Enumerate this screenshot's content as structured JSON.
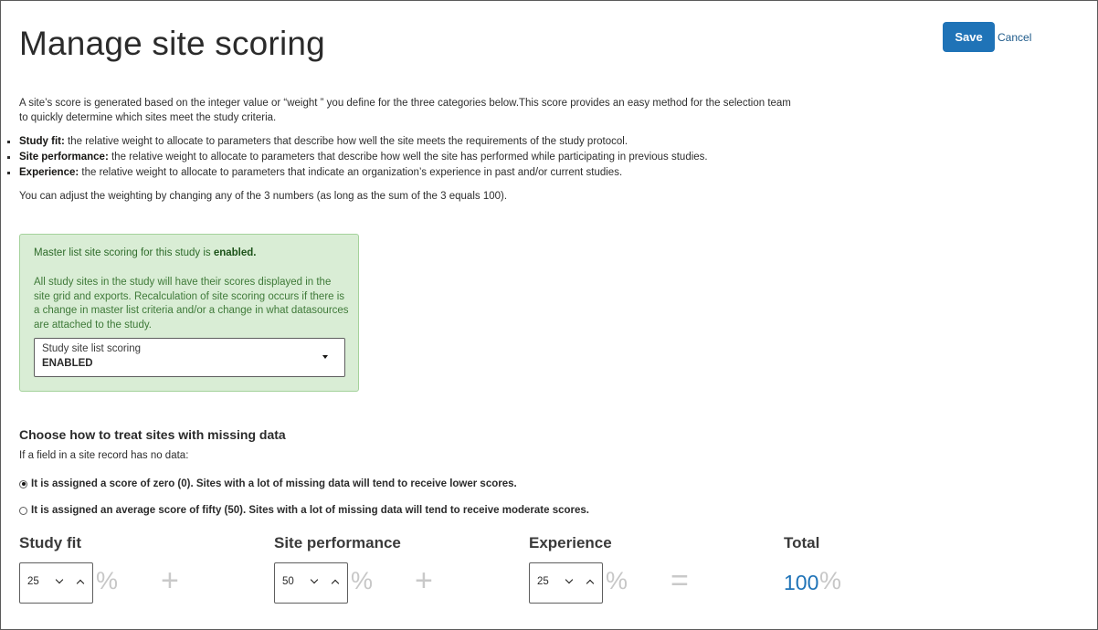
{
  "page": {
    "title": "Manage site scoring",
    "save_label": "Save",
    "cancel_label": "Cancel"
  },
  "intro": {
    "paragraph": "A site’s score is generated based on the integer value or “weight ” you define for the three categories below.This score provides an easy method for the selection team to quickly determine which sites meet the study criteria.",
    "bullets": [
      {
        "term": "Study fit:",
        "text": " the relative weight to allocate to parameters that describe how well the site meets the requirements of the study protocol."
      },
      {
        "term": "Site performance:",
        "text": " the relative weight to allocate to parameters that describe how well the site has performed while participating in previous studies."
      },
      {
        "term": "Experience:",
        "text": " the relative weight to allocate to parameters that indicate an organization’s experience in past and/or current studies."
      }
    ],
    "adjust_note": "You can adjust the weighting by changing any of the 3 numbers (as long as the sum of the 3 equals 100)."
  },
  "status_box": {
    "line_prefix": "Master list site scoring for this study is ",
    "line_status": "enabled.",
    "description": "All study sites in the study will have their scores displayed in the site grid and exports. Recalculation of site scoring occurs if there is a change in master list criteria and/or a change in what datasources are attached to the study.",
    "select_label": "Study site list scoring",
    "select_value": "ENABLED"
  },
  "missing_data": {
    "heading": "Choose how to treat sites with missing data",
    "subtext": "If a field in a site record has no data:",
    "options": [
      {
        "label": "It is assigned a score of zero (0). Sites with a lot of missing data will tend to receive lower scores.",
        "selected": true
      },
      {
        "label": "It is assigned an average score of fifty (50). Sites with a lot of missing data will tend to receive moderate scores.",
        "selected": false
      }
    ]
  },
  "weights": {
    "study_fit": {
      "label": "Study fit",
      "value": "25"
    },
    "site_performance": {
      "label": "Site performance",
      "value": "50"
    },
    "experience": {
      "label": "Experience",
      "value": "25"
    },
    "total": {
      "label": "Total",
      "value": "100"
    },
    "percent_symbol": "%",
    "plus_symbol": "+",
    "equals_symbol": "="
  },
  "colors": {
    "primary": "#1f73b7",
    "status_bg": "#d9edd5",
    "status_border": "#a4d29b"
  }
}
